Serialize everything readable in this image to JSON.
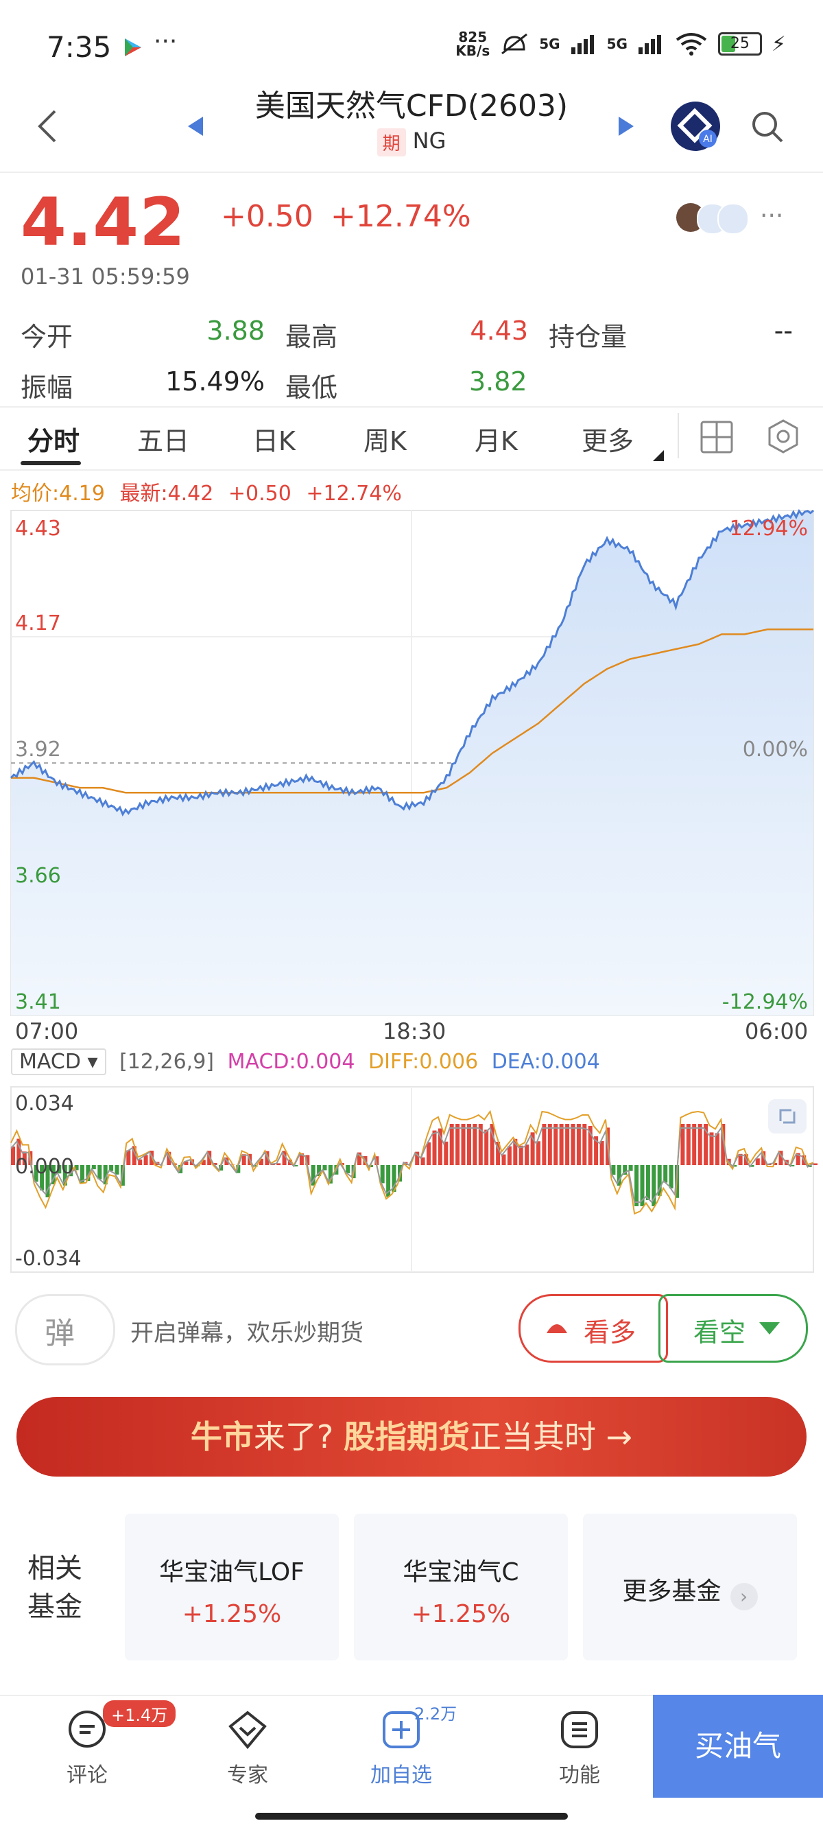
{
  "status_bar": {
    "time": "7:35",
    "net_speed": "825\nKB/s",
    "sig1": "5G",
    "sig2": "5G",
    "battery": "25"
  },
  "nav": {
    "title": "美国天然气CFD(2603)",
    "tag": "期",
    "code": "NG"
  },
  "quote": {
    "price": "4.42",
    "change": "+0.50",
    "change_pct": "+12.74%",
    "time": "01-31 05:59:59"
  },
  "stats": [
    {
      "label": "今开",
      "value": "3.88",
      "color": "#3a9a3e"
    },
    {
      "label": "最高",
      "value": "4.43",
      "color": "#e0443a"
    },
    {
      "label": "持仓量",
      "value": "--",
      "color": "#222222"
    },
    {
      "label": "振幅",
      "value": "15.49%",
      "color": "#222222"
    },
    {
      "label": "最低",
      "value": "3.82",
      "color": "#3a9a3e"
    }
  ],
  "tabs": [
    "分时",
    "五日",
    "日K",
    "周K",
    "月K",
    "更多"
  ],
  "chart_info": {
    "avg": "均价:4.19",
    "latest": "最新:4.42",
    "change": "+0.50",
    "change_pct": "+12.74%"
  },
  "chart_data": {
    "type": "line",
    "y_left_ticks": [
      "4.43",
      "4.17",
      "3.92",
      "3.66",
      "3.41"
    ],
    "y_right_ticks": [
      "12.94%",
      "0.00%",
      "-12.94%"
    ],
    "x_ticks": [
      "07:00",
      "18:30",
      "06:00"
    ],
    "ylim": [
      3.41,
      4.43
    ],
    "series": [
      {
        "values": [
          3.89,
          3.92,
          3.88,
          3.86,
          3.84,
          3.82,
          3.84,
          3.85,
          3.85,
          3.86,
          3.86,
          3.87,
          3.88,
          3.89,
          3.87,
          3.86,
          3.87,
          3.83,
          3.84,
          3.89,
          3.98,
          4.05,
          4.08,
          4.12,
          4.2,
          4.32,
          4.37,
          4.35,
          4.28,
          4.24,
          4.33,
          4.39,
          4.4,
          4.41,
          4.42,
          4.43
        ]
      },
      {
        "values": [
          3.89,
          3.89,
          3.88,
          3.87,
          3.87,
          3.86,
          3.86,
          3.86,
          3.86,
          3.86,
          3.86,
          3.86,
          3.86,
          3.86,
          3.86,
          3.86,
          3.86,
          3.86,
          3.86,
          3.87,
          3.9,
          3.94,
          3.97,
          4.0,
          4.04,
          4.08,
          4.11,
          4.13,
          4.14,
          4.15,
          4.16,
          4.18,
          4.18,
          4.19,
          4.19,
          4.19
        ]
      }
    ]
  },
  "macd": {
    "select": "MACD",
    "params": "[12,26,9]",
    "macd": "MACD:0.004",
    "diff": "DIFF:0.006",
    "dea": "DEA:0.004",
    "y_ticks": [
      "0.034",
      "0.000",
      "-0.034"
    ]
  },
  "danmu": {
    "button": "弹",
    "text": "开启弹幕，欢乐炒期货"
  },
  "bull_label": "看多",
  "bear_label": "看空",
  "banner": {
    "part1": "牛市",
    "part2": "来了? ",
    "part3": "股指期货",
    "part4": "正当其时 →"
  },
  "funds": {
    "label_line1": "相关",
    "label_line2": "基金",
    "cards": [
      {
        "name": "华宝油气LOF",
        "pct": "+1.25%"
      },
      {
        "name": "华宝油气C",
        "pct": "+1.25%"
      }
    ],
    "more": "更多基金"
  },
  "bottom_bar": {
    "comment": "评论",
    "comment_badge": "+1.4万",
    "expert": "专家",
    "add": "加自选",
    "add_count": "2.2万",
    "func": "功能",
    "buy": "买油气"
  }
}
